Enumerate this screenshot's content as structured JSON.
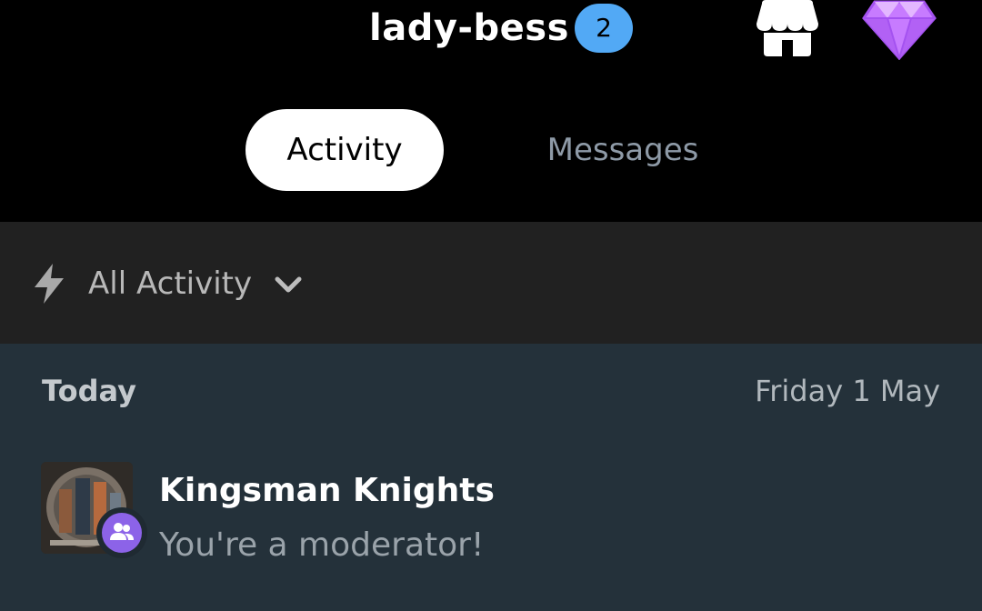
{
  "header": {
    "username": "lady-bess",
    "notification_count": "2",
    "icons": [
      "shop-icon",
      "gem-icon"
    ]
  },
  "tabs": [
    {
      "label": "Activity",
      "selected": true
    },
    {
      "label": "Messages",
      "selected": false
    }
  ],
  "filter": {
    "icon": "bolt-icon",
    "label": "All Activity",
    "dropdown_icon": "chevron-down-icon"
  },
  "feed": {
    "section_label": "Today",
    "section_date": "Friday 1 May",
    "items": [
      {
        "title": "Kingsman Knights",
        "subtitle": "You're a moderator!",
        "badge_icon": "moderator-icon"
      }
    ]
  },
  "colors": {
    "background": "#000000",
    "badge": "#52a9f5",
    "filter_bar": "#212121",
    "feed_background": "#24313a",
    "moderator_badge": "#8c63e8",
    "gem": "#c77bff"
  }
}
